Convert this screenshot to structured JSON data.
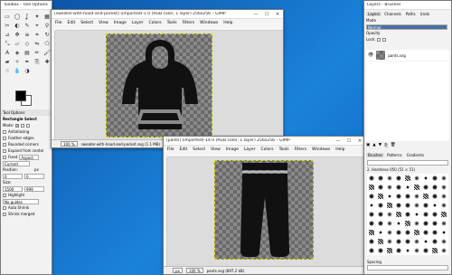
{
  "toolbox": {
    "title": "Toolbox - Tool Options",
    "tool_options_tab": "Tool Options",
    "tool_name": "Rectangle Select",
    "mode_label": "Mode:",
    "antialiasing": "Antialiasing",
    "feather_edges": "Feather edges",
    "rounded_corners": "Rounded corners",
    "expand_from_center": "Expand from center",
    "fixed_label": "Fixed",
    "fixed_value": "Aspect ratio",
    "current": "Current",
    "position_label": "Position:",
    "position_unit": "px",
    "pos_x": "0",
    "pos_y": "0",
    "size_label": "Size:",
    "size_w": "1500",
    "size_h": "999",
    "highlight": "Highlight",
    "guides_value": "No guides",
    "auto_shrink": "Auto Shrink",
    "shrink_merged": "Shrink merged"
  },
  "sweater_window": {
    "title": "[sweater-with-hood-and-pocket] (imported)-1.0 (RGB color, 1 layer) 256x256 – GIMP",
    "menu": [
      "File",
      "Edit",
      "Select",
      "View",
      "Image",
      "Layer",
      "Colors",
      "Tools",
      "Filters",
      "Windows",
      "Help"
    ],
    "zoom": "100 %",
    "status": "sweater-with-hood-and-pocket.svg (1.1 MB)"
  },
  "pants_window": {
    "title": "[pants] (imported)-14.0 (RGB color, 1 layer) 256x256 – GIMP",
    "menu": [
      "File",
      "Edit",
      "Select",
      "View",
      "Image",
      "Layer",
      "Colors",
      "Tools",
      "Filters",
      "Windows",
      "Help"
    ],
    "unit": "px",
    "zoom": "100 %",
    "status": "pants.svg (897.2 kB)"
  },
  "layers": {
    "title": "Layers - Brushes",
    "tabs": [
      "Layers",
      "Channels",
      "Paths",
      "Undo"
    ],
    "mode_label": "Mode",
    "mode_value": "Normal",
    "opacity_label": "Opacity",
    "lock_label": "Lock:",
    "layer_name": "pants.svg"
  },
  "brushes": {
    "tabs": [
      "Brushes",
      "Patterns",
      "Gradients"
    ],
    "filter_placeholder": "filter",
    "brush_name": "2. Hardness 050 (51 × 51)",
    "spacing_label": "Spacing"
  },
  "colors": {
    "accent": "#1070c8",
    "foreground": "#000000",
    "background": "#ffffff",
    "icon_silhouette": "#111111"
  }
}
